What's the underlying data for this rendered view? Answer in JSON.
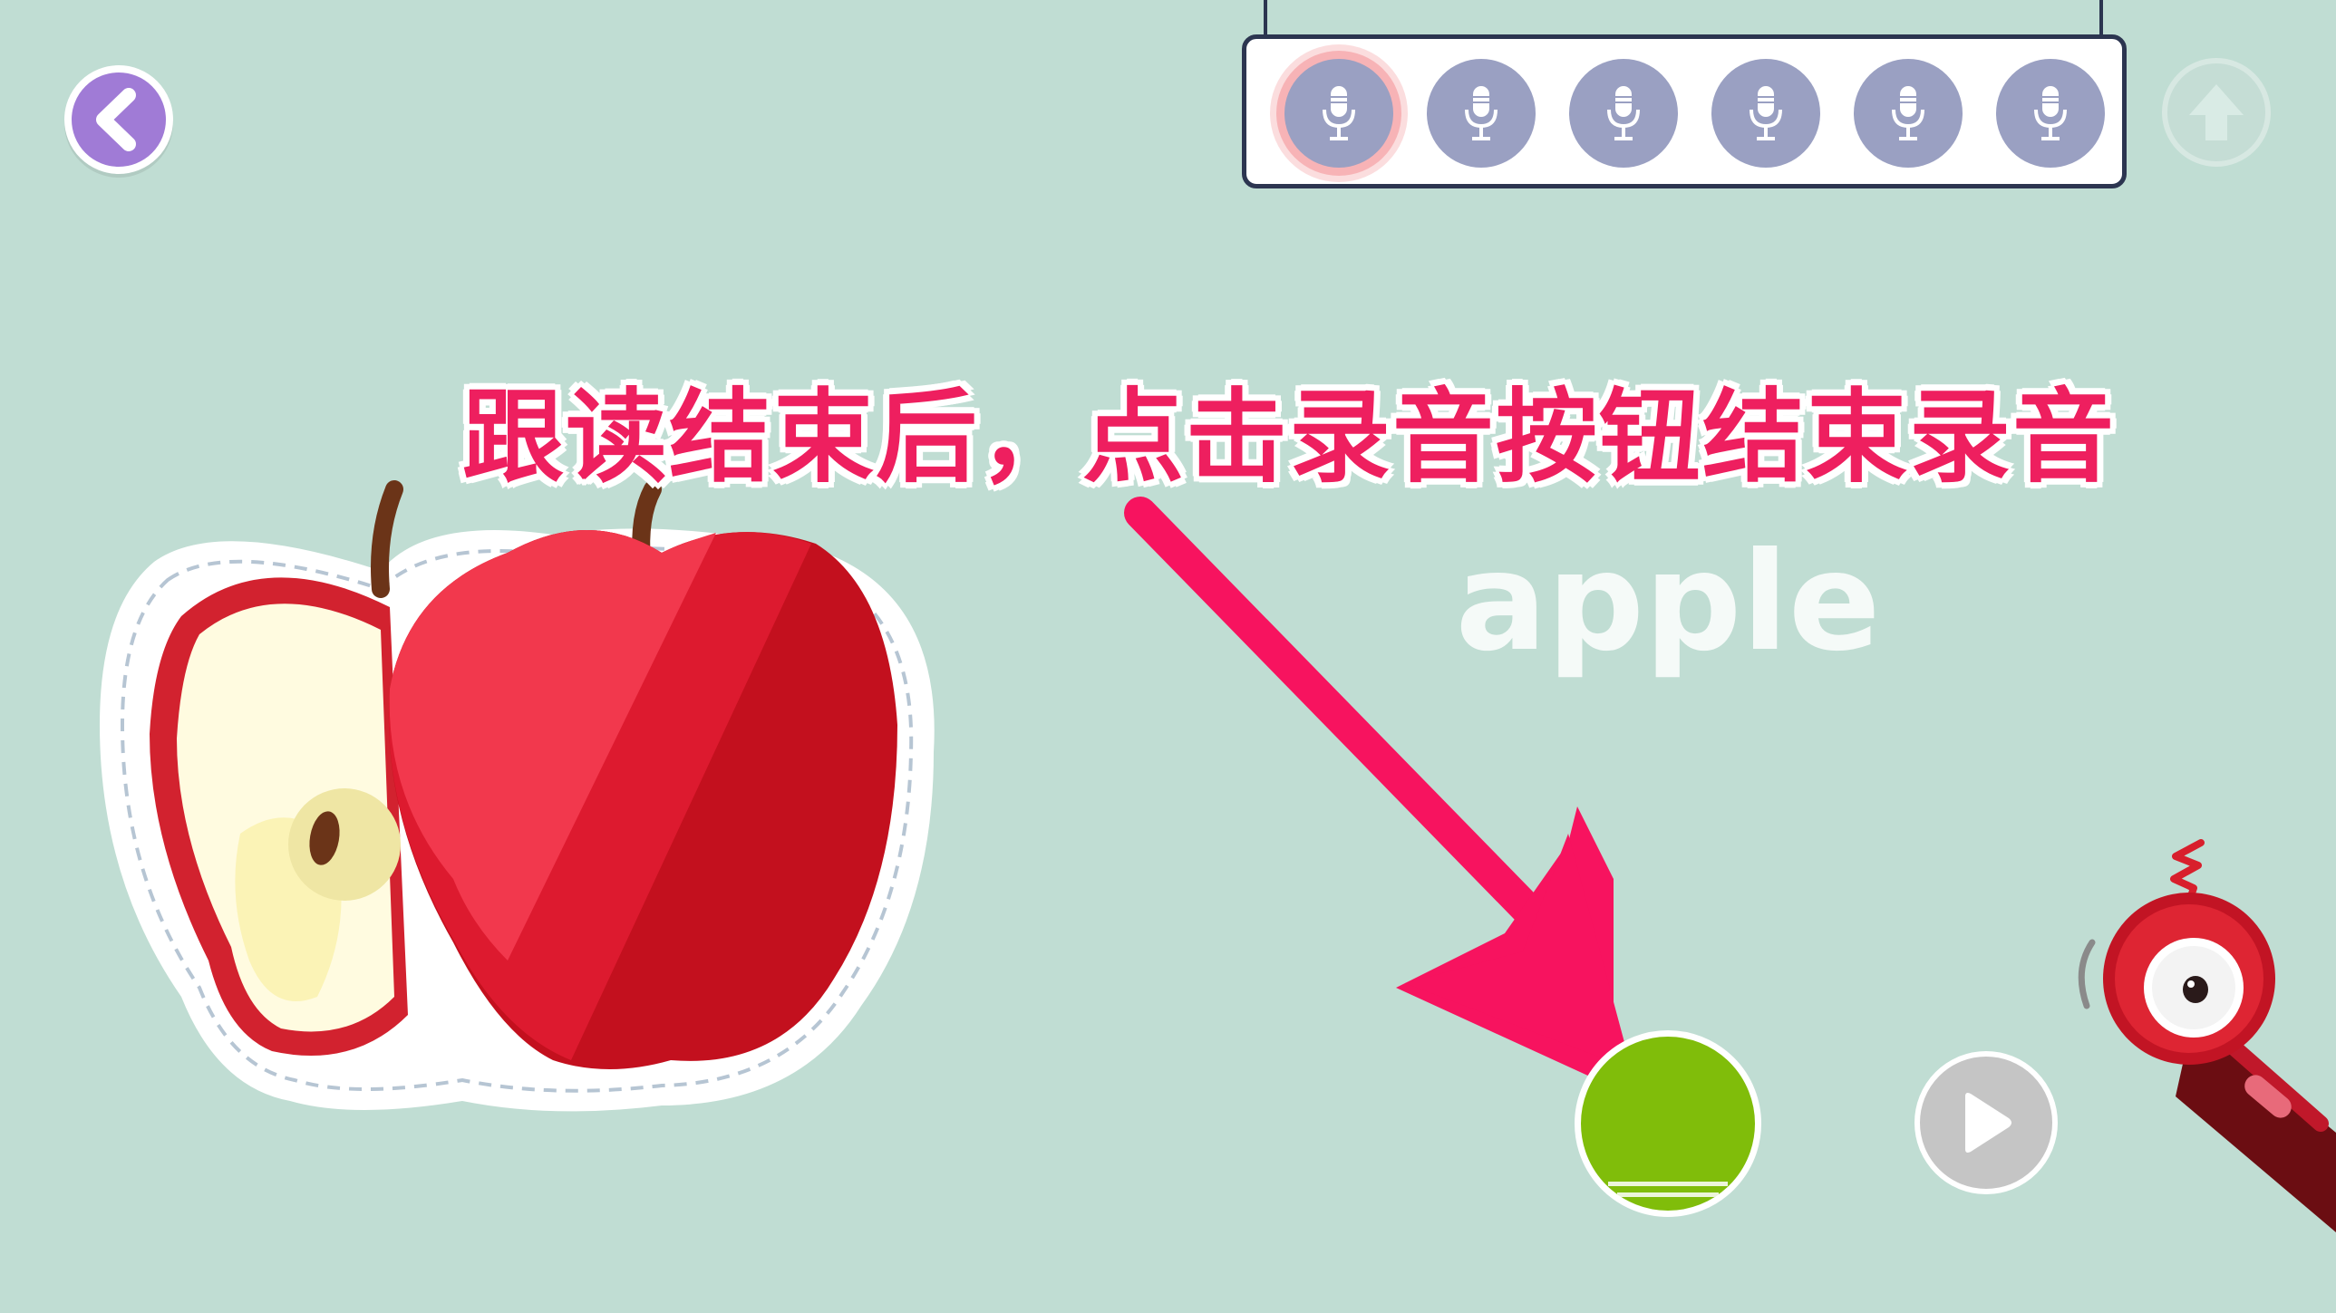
{
  "toolbar": {
    "back_icon": "chevron-left-icon",
    "upload_icon": "arrow-up-icon",
    "recording_slots": [
      {
        "icon": "microphone-icon",
        "state": "active"
      },
      {
        "icon": "microphone-icon",
        "state": "idle"
      },
      {
        "icon": "microphone-icon",
        "state": "idle"
      },
      {
        "icon": "microphone-icon",
        "state": "idle"
      },
      {
        "icon": "microphone-icon",
        "state": "idle"
      },
      {
        "icon": "microphone-icon",
        "state": "idle"
      }
    ]
  },
  "lesson": {
    "instruction": "跟读结束后，点击录音按钮结束录音",
    "word": "apple",
    "image": "apple-illustration"
  },
  "controls": {
    "record_icon": "record-icon",
    "play_icon": "play-icon",
    "mascot": "microphone-mascot"
  },
  "colors": {
    "background": "#c0ddd3",
    "accent_purple": "#a07bd6",
    "instruction_pink": "#ee1f5f",
    "record_green": "#80bd0a",
    "slot_gray": "#9aa0c2"
  }
}
